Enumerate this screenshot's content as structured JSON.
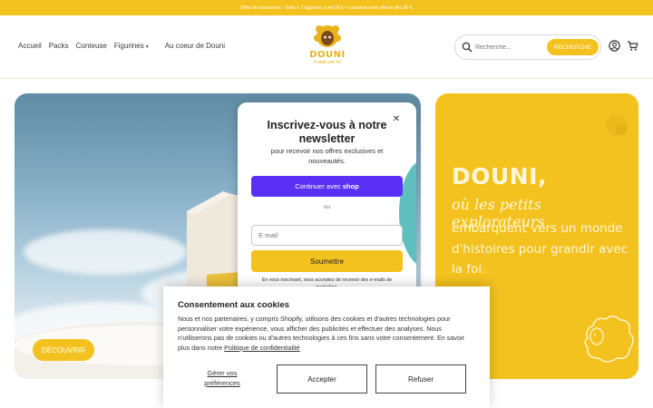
{
  "colors": {
    "brand_yellow": "#f3c21f",
    "shop_purple": "#5a31f4",
    "teal": "#5fbfbe",
    "cream_text": "#fdf6d8"
  },
  "announcement": "Offre de lancement  –  Bébi + 2 figurines à 44,90 €  •  Livraison mise offerte dès 80 €",
  "nav": {
    "items": [
      "Accueil",
      "Packs",
      "Conteuse",
      "Figurines",
      "Au coeur de Douni"
    ]
  },
  "logo": {
    "word": "DOUNI",
    "tagline": "Il était une foi"
  },
  "search": {
    "placeholder": "Recherche...",
    "button": "RECHERCHE"
  },
  "icons": {
    "search": "search-icon",
    "user": "user-icon",
    "cart": "cart-icon",
    "close": "close-icon",
    "caret": "chevron-down-icon"
  },
  "hero": {
    "button": "DÉCOUVRIR"
  },
  "promo": {
    "brand": "DOUNI,",
    "line1": "où les petits explorateurs",
    "text": "embarquent vers un monde d'histoires pour grandir avec la foi."
  },
  "newsletter": {
    "title": "Inscrivez-vous à notre newsletter",
    "subtitle": "pour recevoir nos offres exclusives et nouveautés.",
    "shop_prefix": "Continuer avec",
    "shop_brand": "shop",
    "or": "ou",
    "email_placeholder": "E-mail",
    "submit": "Soumettre",
    "legal": "En vous inscrivant, vous acceptez de recevoir des e-mails de marketing."
  },
  "cookies": {
    "title": "Consentement aux cookies",
    "body": "Nous et nos partenaires, y compris Shopify, utilisons des cookies et d'autres technologies pour personnaliser votre expérience, vous afficher des publicités et effectuer des analyses. Nous n'utiliserons pas de cookies ou d'autres technologies à ces fins sans votre consentement. En savoir plus dans notre",
    "link": "Politique de confidentialité",
    "manage": "Gérer vos préférences",
    "accept": "Accepter",
    "refuse": "Refuser"
  }
}
